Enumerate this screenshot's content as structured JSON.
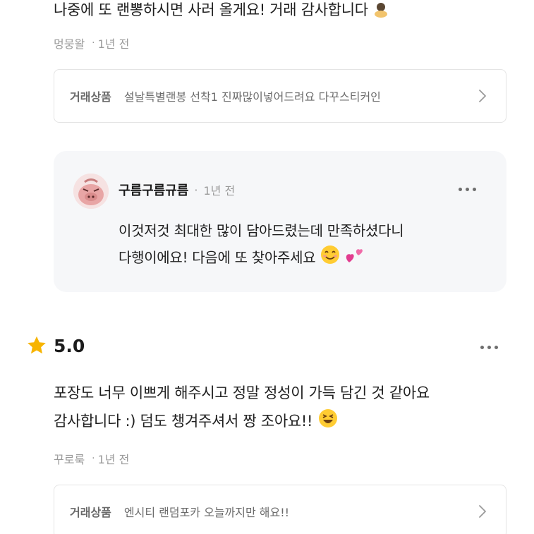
{
  "review1": {
    "text_tail": "나중에 또 랜뽕하시면 사러 올게요! 거래 감사합니다",
    "author": "멍뭉왈",
    "time": "1년 전",
    "product_label": "거래상품",
    "product_name": "설날특별랜봉 선착1 진짜많이넣어드려요 다꾸스티커인"
  },
  "reply": {
    "seller_name": "구름구름규름",
    "time": "1년 전",
    "line1": "이것저것 최대한 많이 담아드렸는데 만족하셨다니",
    "line2": "다행이에요! 다음에 또 찾아주세요"
  },
  "review2": {
    "rating": "5.0",
    "line1": "포장도 너무 이쁘게 해주시고 정말 정성이 가득 담긴 것 같아요",
    "line2": "감사합니다 :) 덤도 챙겨주셔서 짱 조아요!!",
    "author": "꾸로룩",
    "time": "1년 전",
    "product_label": "거래상품",
    "product_name": "엔시티 랜덤포카 오늘까지만 해요!!"
  },
  "icons": {
    "star": "star-icon",
    "more": "more-options-icon",
    "chevron": "chevron-right-icon",
    "emoji_smile": "smiling-face-emoji",
    "emoji_hearts": "two-hearts-emoji",
    "emoji_laugh": "laughing-face-emoji",
    "emoji_bow": "bowing-person-emoji"
  },
  "colors": {
    "star": "#F7B400",
    "reply_bg": "#F6F7F9",
    "border": "#E4E4E4",
    "meta": "#9A9A9A"
  }
}
